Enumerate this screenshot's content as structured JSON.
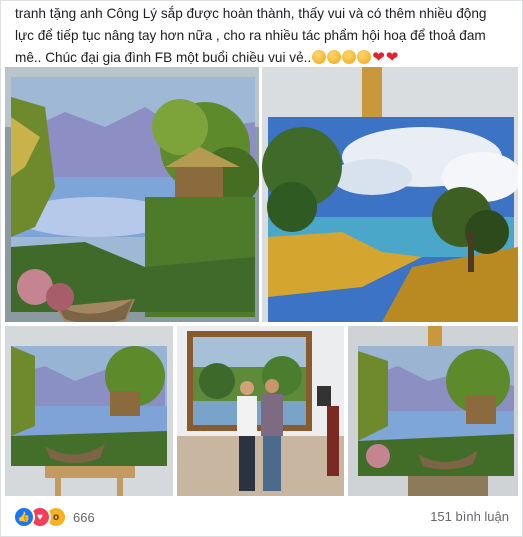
{
  "post": {
    "text_line1": "tranh tặng anh Công Lý sắp được hoàn thành, thấy vui và có thêm nhiều động",
    "text_line2": "lực để tiếp tục nâng tay hơn nữa , cho ra nhiều tác phẩm hội hoạ để thoả đam",
    "text_line3": "mê.. Chúc đại gia đình FB một buổi chiều vui vẻ.."
  },
  "reactions": {
    "icons": [
      "like-icon",
      "love-icon",
      "wow-icon"
    ],
    "count": "666"
  },
  "comments": {
    "label": "151 bình luận"
  },
  "colors": {
    "like": "#1877f2",
    "love": "#f33e58",
    "wow": "#f7b125",
    "meta_text": "#65676b"
  }
}
